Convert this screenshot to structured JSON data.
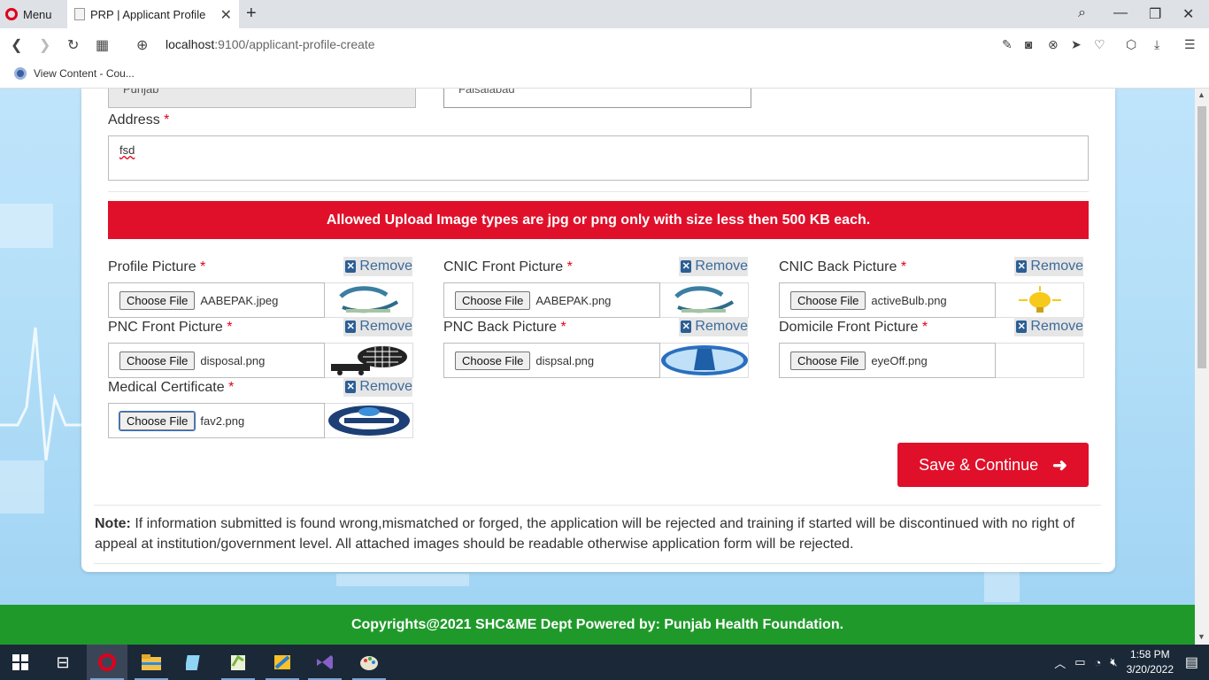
{
  "browser": {
    "menu_label": "Menu",
    "tab_title": "PRP | Applicant Profile",
    "url_host": "localhost",
    "url_path": ":9100/applicant-profile-create",
    "bookmark": "View Content - Cou..."
  },
  "form": {
    "province_value": "Punjab",
    "district_value": "Faisalabad",
    "address_label": "Address",
    "address_value": "fsd",
    "required_mark": "*",
    "alert": "Allowed Upload Image types are jpg or png only with size less then 500 KB each.",
    "remove_label": "Remove",
    "choose_label": "Choose File",
    "uploads": [
      {
        "label": "Profile Picture",
        "file": "AABEPAK.jpeg",
        "thumb": "logo-swoosh"
      },
      {
        "label": "CNIC Front Picture",
        "file": "AABEPAK.png",
        "thumb": "logo-swoosh"
      },
      {
        "label": "CNIC Back Picture",
        "file": "activeBulb.png",
        "thumb": "bulb"
      },
      {
        "label": "PNC Front Picture",
        "file": "disposal.png",
        "thumb": "truck"
      },
      {
        "label": "PNC Back Picture",
        "file": "dispsal.png",
        "thumb": "water"
      },
      {
        "label": "Domicile Front Picture",
        "file": "eyeOff.png",
        "thumb": "empty"
      },
      {
        "label": "Medical Certificate",
        "file": "fav2.png",
        "thumb": "emblem"
      }
    ],
    "save_label": "Save & Continue",
    "note_bold": "Note:",
    "note_text": " If information submitted is found wrong,mismatched or forged, the application will be rejected and training if started will be discontinued with no right of appeal at institution/government level. All attached images should be readable otherwise application form will be rejected."
  },
  "footer": "Copyrights@2021 SHC&ME Dept Powered by: Punjab Health Foundation.",
  "taskbar": {
    "time": "1:58 PM",
    "date": "3/20/2022"
  },
  "colors": {
    "accent_red": "#e0102a",
    "footer_green": "#1f9a2a",
    "remove_blue": "#3d6a9a"
  }
}
